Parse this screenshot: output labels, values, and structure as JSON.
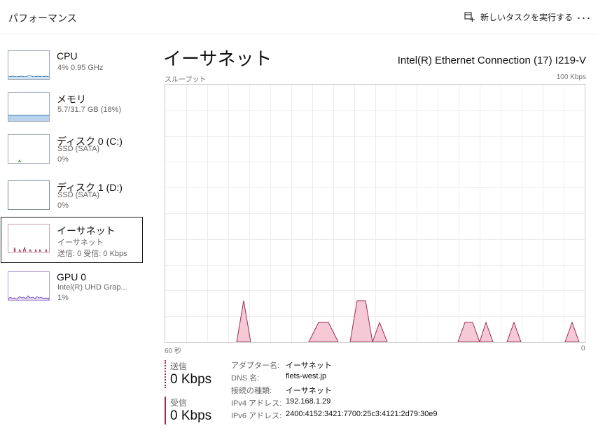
{
  "app": {
    "title": "パフォーマンス"
  },
  "toolbar": {
    "run_task_label": "新しいタスクを実行する",
    "more_label": "···"
  },
  "sidebar": {
    "items": [
      {
        "name": "CPU",
        "line1": "4%  0.95 GHz",
        "line2": ""
      },
      {
        "name": "メモリ",
        "line1": "5.7/31.7 GB (18%)",
        "line2": ""
      },
      {
        "name": "ディスク 0 (C:)",
        "line1": "SSD (SATA)",
        "line2": "0%"
      },
      {
        "name": "ディスク 1 (D:)",
        "line1": "SSD (SATA)",
        "line2": "0%"
      },
      {
        "name": "イーサネット",
        "line1": "イーサネット",
        "line2": "送信: 0  受信: 0 Kbps"
      },
      {
        "name": "GPU 0",
        "line1": "Intel(R) UHD Grap...",
        "line2": "1%"
      }
    ],
    "selected": "イーサネット"
  },
  "main": {
    "title": "イーサネット",
    "adapter": "Intel(R) Ethernet Connection (17) I219-V",
    "graph": {
      "label": "スループット",
      "max_label": "100 Kbps",
      "left_time": "60 秒",
      "right_time": "0",
      "fill_color": "#f6c9d6",
      "line_color": "#9b2c57"
    },
    "send": {
      "label": "送信",
      "value": "0 Kbps",
      "color": "#9b2c57"
    },
    "recv": {
      "label": "受信",
      "value": "0 Kbps",
      "color": "#9b2c57"
    },
    "properties": [
      {
        "key": "アダプター名:",
        "value": "イーサネット"
      },
      {
        "key": "DNS 名:",
        "value": "flets-west.jp"
      },
      {
        "key": "接続の種類:",
        "value": "イーサネット"
      },
      {
        "key": "IPv4 アドレス:",
        "value": "192.168.1.29"
      },
      {
        "key": "IPv6 アドレス:",
        "value": "2400:4152:3421:7700:25c3:4121:2d79:30e9"
      }
    ]
  }
}
